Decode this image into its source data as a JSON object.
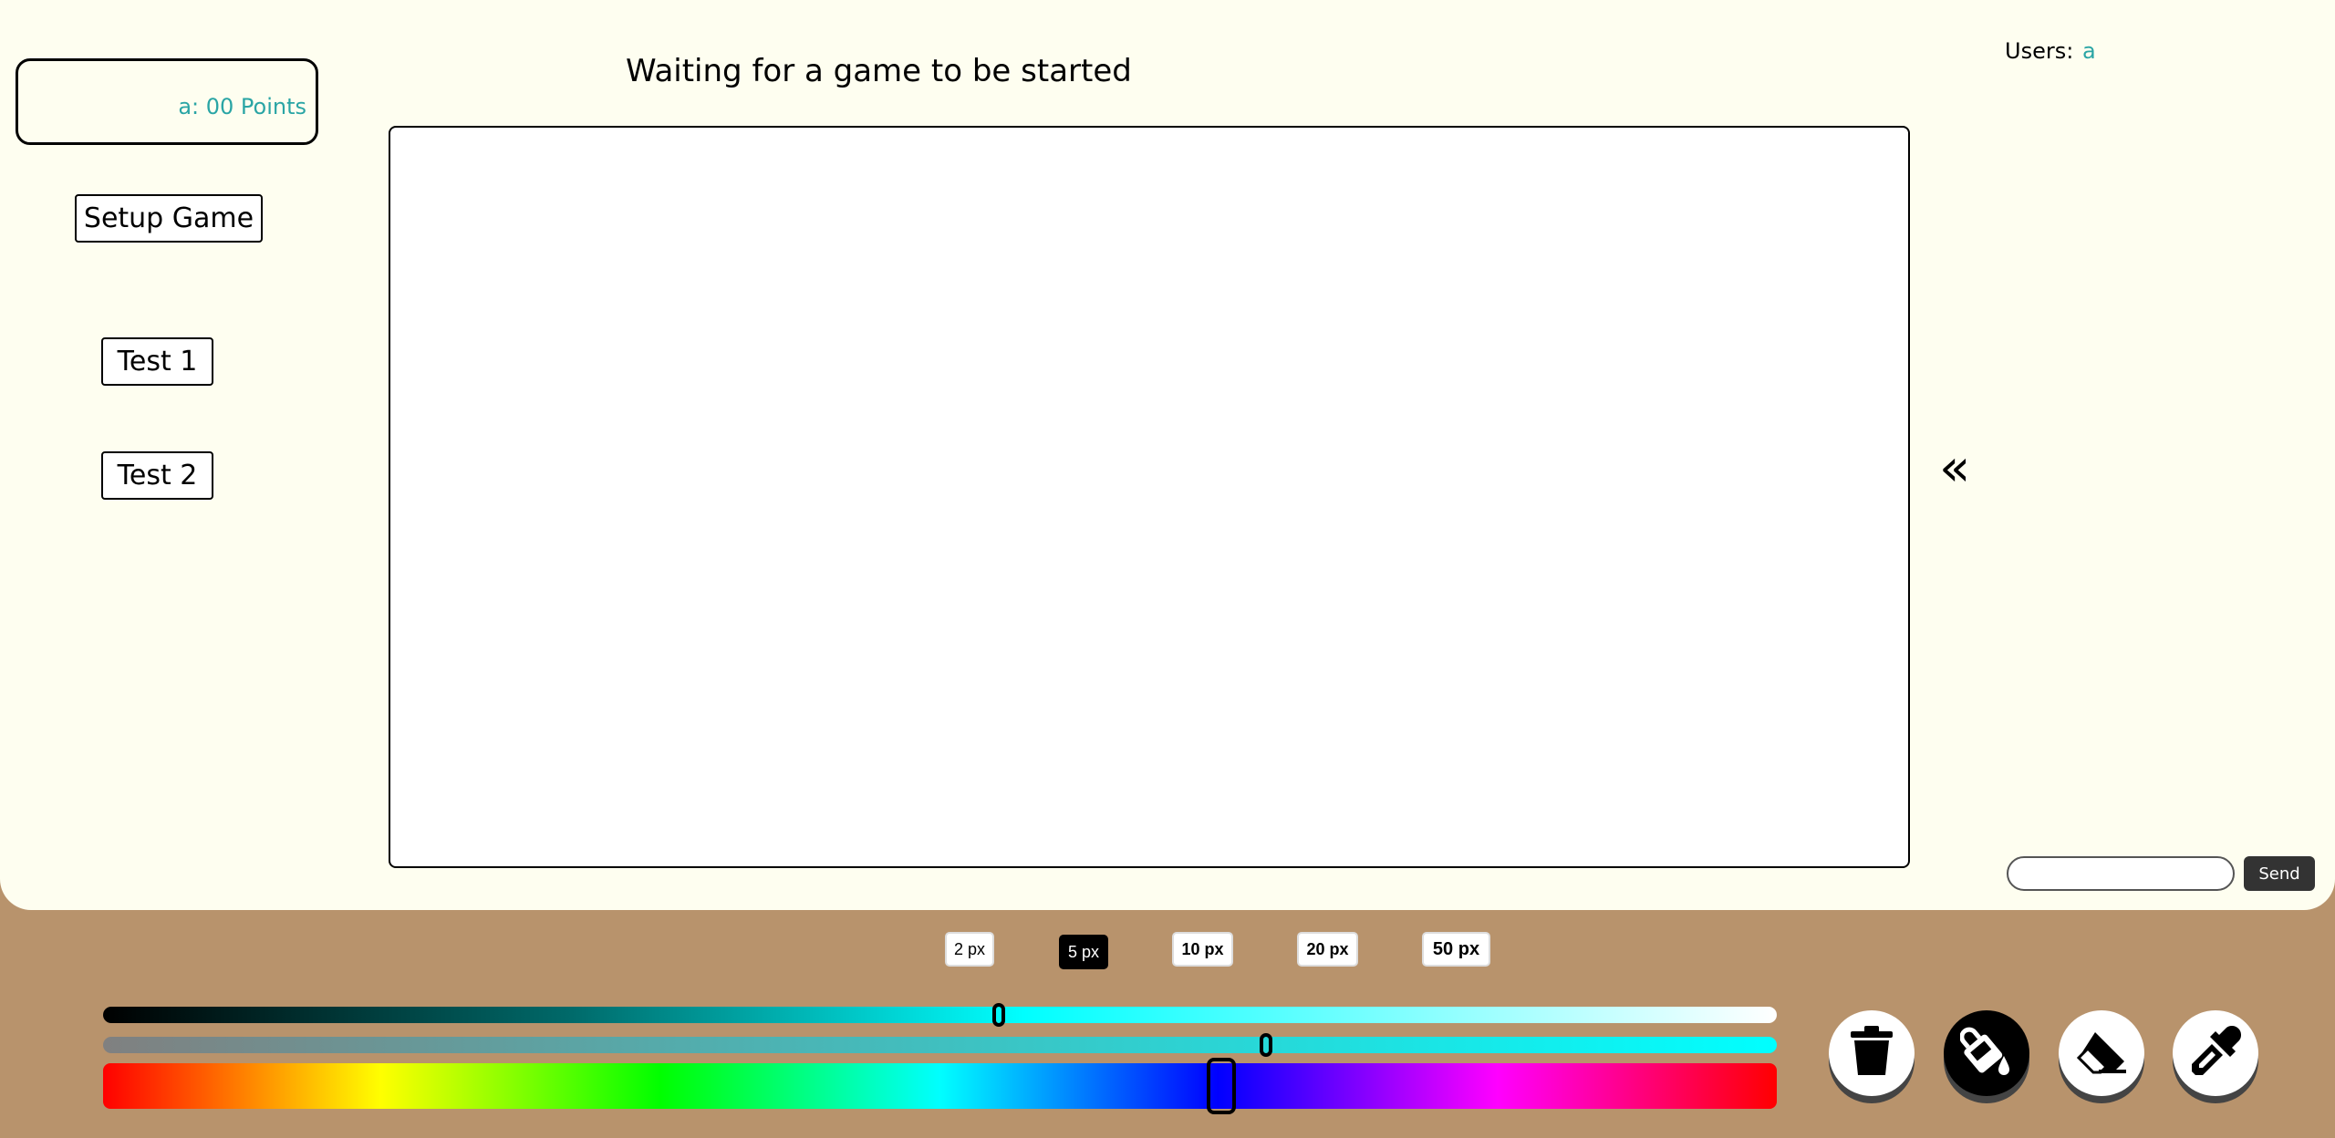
{
  "scoreboard": {
    "entry": "a: 00 Points"
  },
  "buttons": {
    "setup_game": "Setup Game",
    "test1": "Test 1",
    "test2": "Test 2"
  },
  "status": "Waiting for a game to be started",
  "collapse_glyph": "«",
  "users": {
    "label": "Users:",
    "names": [
      "a"
    ]
  },
  "chat": {
    "input_value": "",
    "send": "Send"
  },
  "brush_sizes": [
    {
      "label": "2 px",
      "active": false
    },
    {
      "label": "5 px",
      "active": true
    },
    {
      "label": "10 px",
      "active": false
    },
    {
      "label": "20 px",
      "active": false
    },
    {
      "label": "50 px",
      "active": false
    }
  ],
  "color_sliders": {
    "lightness": 0.535,
    "saturation": 0.695,
    "hue": 0.668
  },
  "tools": [
    {
      "name": "trash-icon",
      "active": false
    },
    {
      "name": "paint-bucket-icon",
      "active": true
    },
    {
      "name": "eraser-icon",
      "active": false
    },
    {
      "name": "eyedropper-icon",
      "active": false
    }
  ],
  "colors": {
    "accent": "#2aa5a5",
    "panel_bg": "#fefef0",
    "page_bg": "#b8936c"
  }
}
